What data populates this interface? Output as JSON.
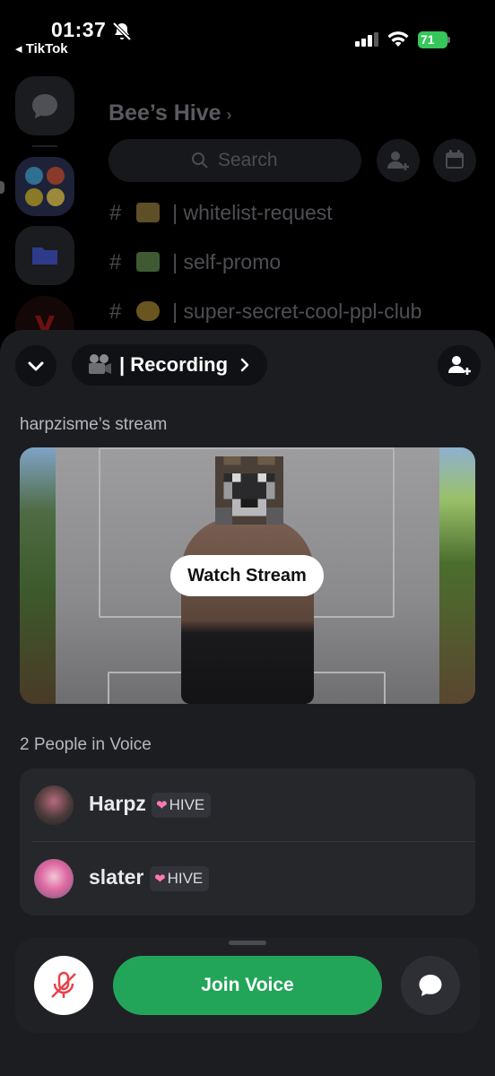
{
  "status_bar": {
    "time": "01:37",
    "back_app": "◂ TikTok",
    "battery_pct": "71",
    "battery_color": "#35c759"
  },
  "server": {
    "name": "Bee’s Hive",
    "chevron": "›",
    "search_placeholder": "Search",
    "channels": [
      {
        "hash": "#",
        "emoji": "lock-emoji",
        "name": "| whitelist-request"
      },
      {
        "hash": "#",
        "emoji": "money-emoji",
        "name": "| self-promo"
      },
      {
        "hash": "#",
        "emoji": "nerd-face-emoji",
        "name": "| super-secret-cool-ppl-club"
      }
    ]
  },
  "voice_sheet": {
    "channel_name": "| Recording",
    "stream_label": "harpzisme’s stream",
    "watch_stream_label": "Watch Stream",
    "people_label": "2 People in Voice",
    "members": [
      {
        "name": "Harpz",
        "badge": "HIVE",
        "badge_icon": "heart-icon"
      },
      {
        "name": "slater",
        "badge": "HIVE",
        "badge_icon": "heart-icon"
      }
    ],
    "join_voice_label": "Join Voice",
    "accent_green": "#23a559",
    "mute_icon_color": "#e8424a"
  }
}
